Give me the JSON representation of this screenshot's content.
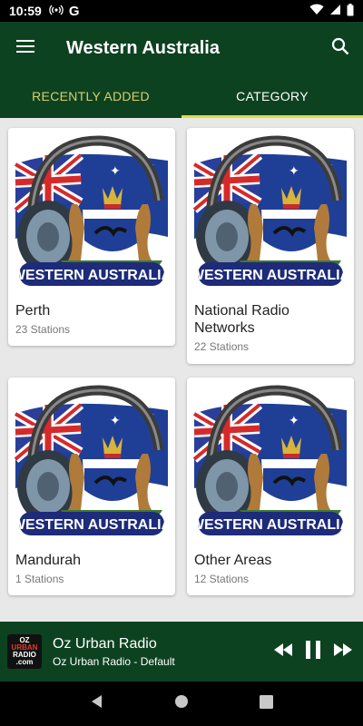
{
  "status_bar": {
    "time": "10:59",
    "g_label": "G"
  },
  "app_bar": {
    "title": "Western Australia",
    "menu_icon": "menu-icon",
    "search_icon": "search-icon"
  },
  "tabs": [
    {
      "label": "RECENTLY ADDED",
      "active": false
    },
    {
      "label": "CATEGORY",
      "active": true
    }
  ],
  "banner_text": "WESTERN AUSTRALIA",
  "categories": [
    {
      "name": "Perth",
      "count": "23 Stations"
    },
    {
      "name": "National Radio Networks",
      "count": "22 Stations"
    },
    {
      "name": "Mandurah",
      "count": "1 Stations"
    },
    {
      "name": "Other Areas",
      "count": "12 Stations"
    }
  ],
  "player": {
    "logo_lines": [
      "OZ",
      "URBAN",
      "RADIO",
      ".com"
    ],
    "title": "Oz Urban Radio",
    "subtitle": "Oz Urban Radio - Default"
  },
  "colors": {
    "primary": "#0d4221",
    "tab_indicator": "#e2dc3a",
    "inactive_tab": "#d8cf6a"
  }
}
